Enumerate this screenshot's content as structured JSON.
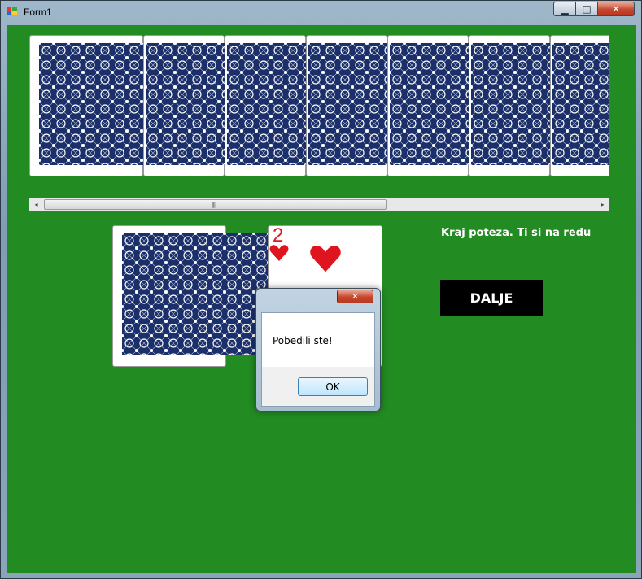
{
  "window": {
    "title": "Form1",
    "controls": {
      "minimize": "▁",
      "maximize": "□",
      "close": "✕"
    }
  },
  "hand": {
    "card_count_visible": 7,
    "card_back_color": "#1b2f6b"
  },
  "scrollbar": {
    "left_arrow": "◂",
    "right_arrow": "▸",
    "grip": "|||"
  },
  "table": {
    "deck_back_color": "#1b2f6b",
    "played_card": {
      "rank": "2",
      "suit": "hearts",
      "suit_color": "#e0141e"
    }
  },
  "status": {
    "text": "Kraj poteza. Ti si na redu"
  },
  "buttons": {
    "dalje": "DALJE"
  },
  "dialog": {
    "close": "✕",
    "message": "Pobedili ste!",
    "ok": "OK"
  },
  "colors": {
    "table_green": "#228b22"
  }
}
